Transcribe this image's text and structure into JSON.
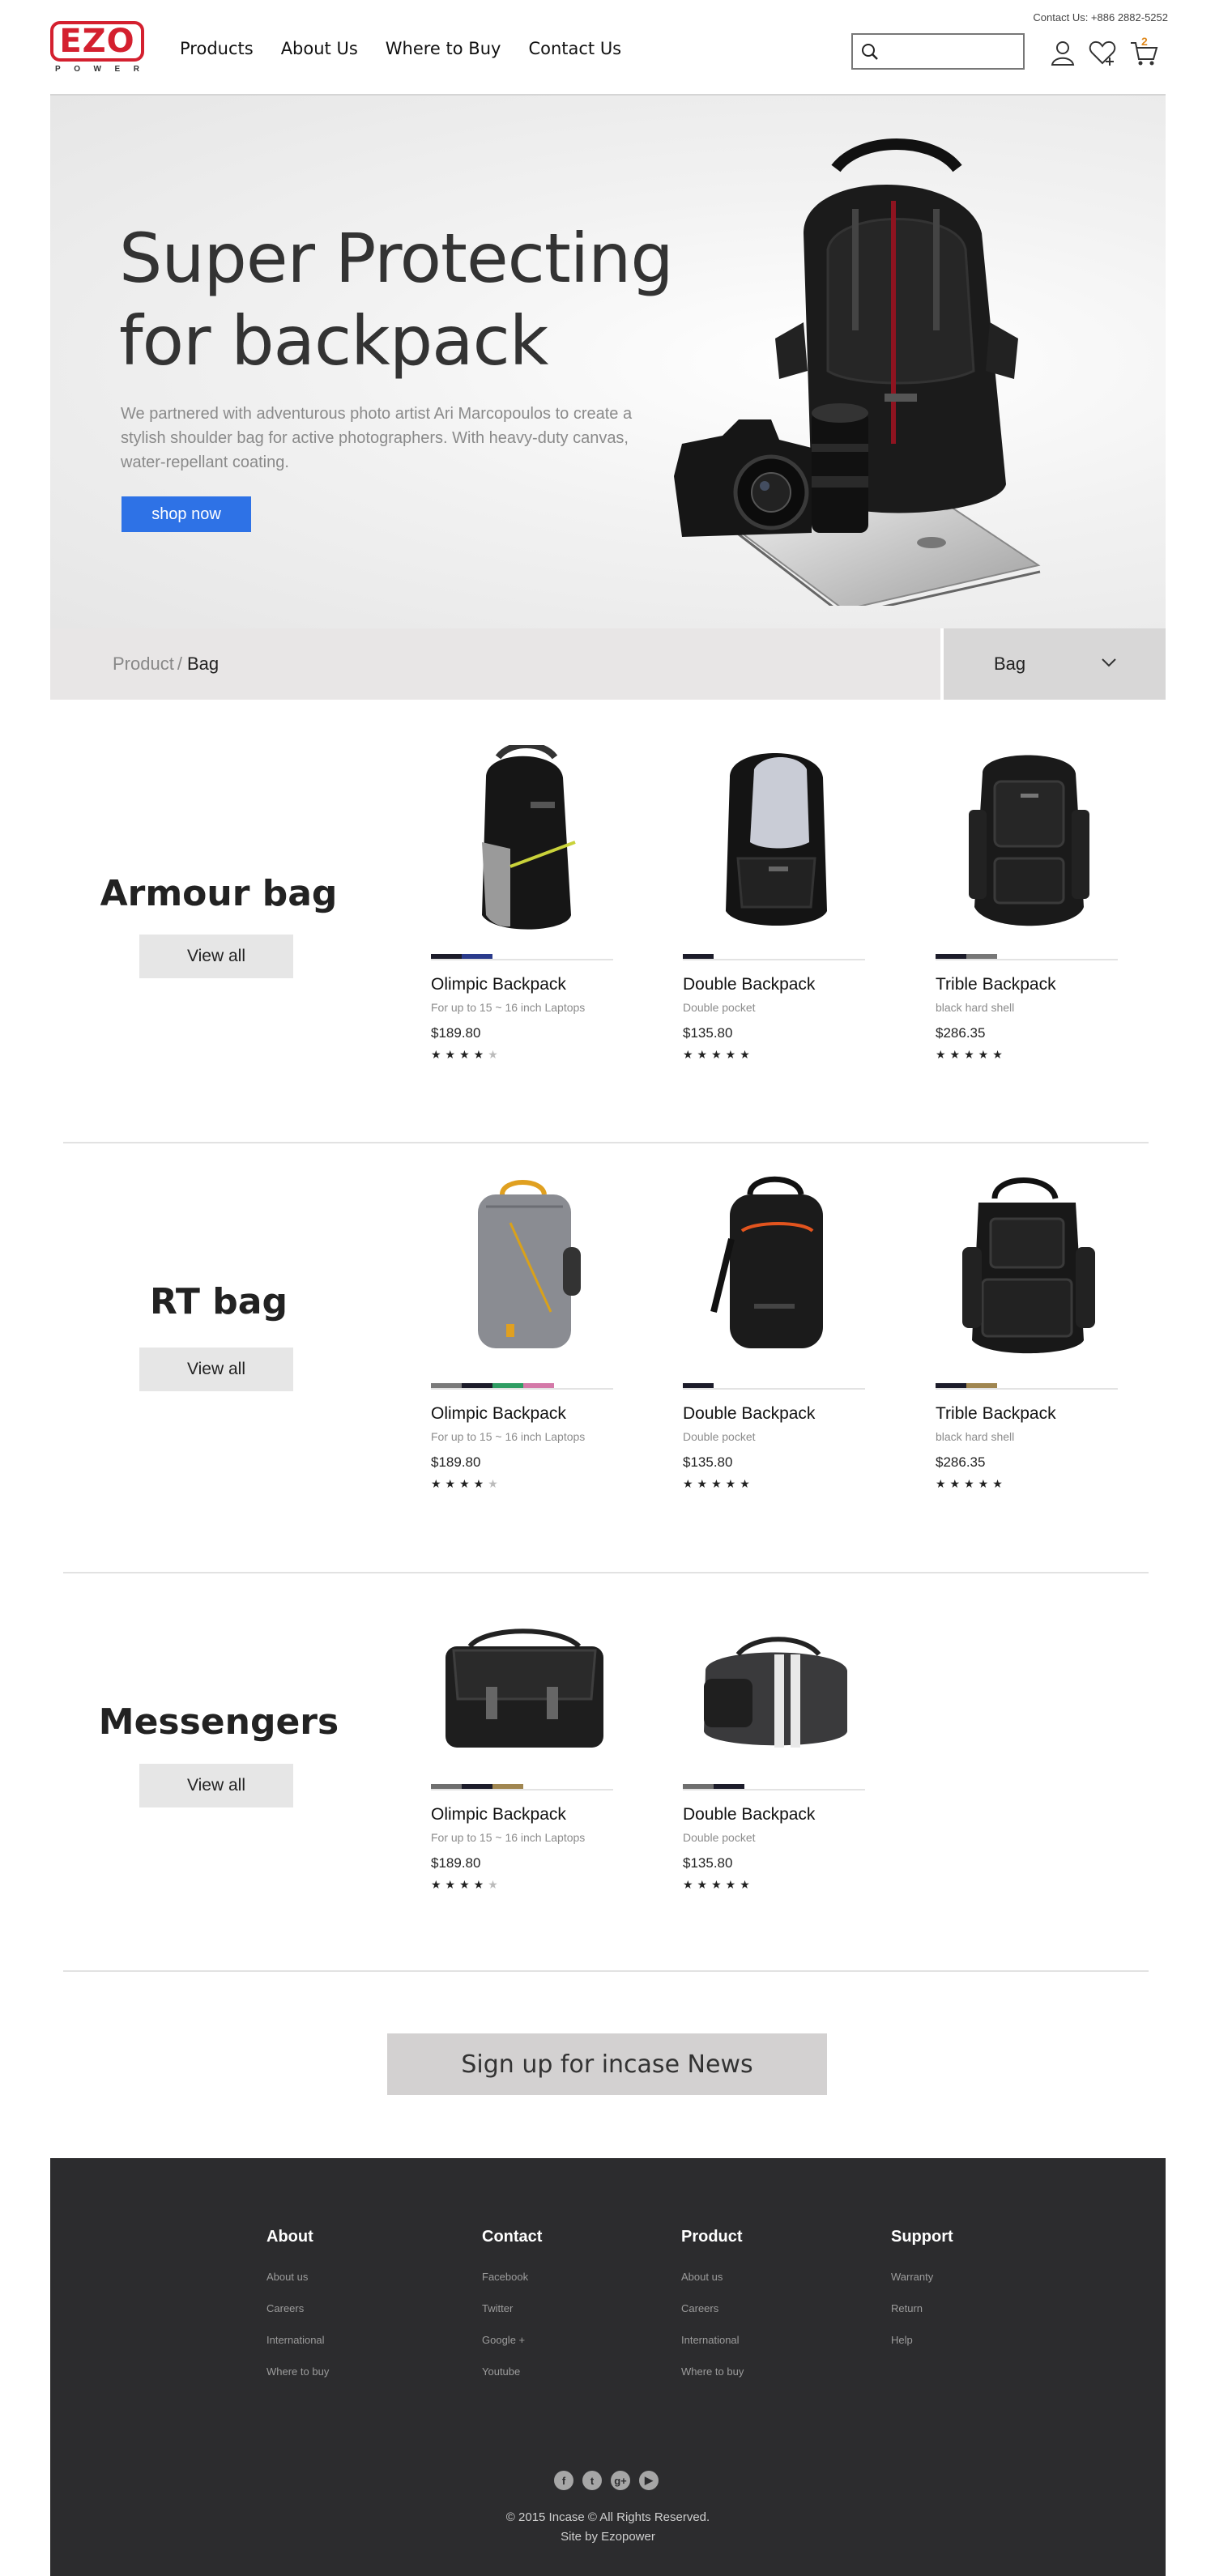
{
  "header": {
    "contact": "Contact Us: +886 2882-5252",
    "logo": {
      "main": "EZO",
      "sub": [
        "P",
        "O",
        "W",
        "E",
        "R"
      ]
    },
    "nav": [
      "Products",
      "About Us",
      "Where to Buy",
      "Contact Us"
    ],
    "search_placeholder": "",
    "cart_count": "2"
  },
  "hero": {
    "title_line1": "Super Protecting",
    "title_line2": "for backpack",
    "description": "We partnered with adventurous photo artist Ari Marcopoulos to create a stylish shoulder bag for active photographers. With heavy-duty canvas, water-repellant coating.",
    "button": "shop now"
  },
  "breadcrumb": {
    "parent": "Product",
    "separator": "/",
    "current": "Bag"
  },
  "category_select": {
    "value": "Bag"
  },
  "colors": {
    "accent": "#2e72e6",
    "brand": "#d4202f",
    "star_on": "#222222",
    "star_off": "#bbbbbb"
  },
  "sections": [
    {
      "title": "Armour bag",
      "view_all": "View all",
      "products": [
        {
          "name": "Olimpic Backpack",
          "sub": "For up to 15 ~ 16 inch Laptops",
          "price": "$189.80",
          "rating": 4,
          "swatches": [
            "#1c1c2a",
            "#2a3b8c"
          ]
        },
        {
          "name": "Double Backpack",
          "sub": "Double pocket",
          "price": "$135.80",
          "rating": 5,
          "swatches": [
            "#1c1c2a"
          ]
        },
        {
          "name": "Trible Backpack",
          "sub": "black hard shell",
          "price": "$286.35",
          "rating": 5,
          "swatches": [
            "#1c1c2a",
            "#777777"
          ]
        }
      ]
    },
    {
      "title": "RT bag",
      "view_all": "View all",
      "products": [
        {
          "name": "Olimpic Backpack",
          "sub": "For up to 15 ~ 16 inch Laptops",
          "price": "$189.80",
          "rating": 4,
          "swatches": [
            "#7a7a7a",
            "#1c1c2a",
            "#2f9d63",
            "#d479a8"
          ]
        },
        {
          "name": "Double Backpack",
          "sub": "Double pocket",
          "price": "$135.80",
          "rating": 5,
          "swatches": [
            "#1c1c2a"
          ]
        },
        {
          "name": "Trible Backpack",
          "sub": "black hard shell",
          "price": "$286.35",
          "rating": 5,
          "swatches": [
            "#1c1c2a",
            "#a08650"
          ]
        }
      ]
    },
    {
      "title": "Messengers",
      "view_all": "View all",
      "products": [
        {
          "name": "Olimpic Backpack",
          "sub": "For up to 15 ~ 16 inch Laptops",
          "price": "$189.80",
          "rating": 4,
          "swatches": [
            "#6f6f6f",
            "#1c1c2a",
            "#a08650"
          ]
        },
        {
          "name": "Double Backpack",
          "sub": "Double pocket",
          "price": "$135.80",
          "rating": 5,
          "swatches": [
            "#6f6f6f",
            "#1c1c2a"
          ]
        }
      ]
    }
  ],
  "signup": "Sign up for incase News",
  "footer": {
    "columns": [
      {
        "title": "About",
        "links": [
          "About us",
          "Careers",
          "International",
          "Where to buy"
        ]
      },
      {
        "title": "Contact",
        "links": [
          "Facebook",
          "Twitter",
          "Google +",
          "Youtube"
        ]
      },
      {
        "title": "Product",
        "links": [
          "About us",
          "Careers",
          "International",
          "Where to buy"
        ]
      },
      {
        "title": "Support",
        "links": [
          "Warranty",
          "Return",
          "Help"
        ]
      }
    ],
    "social": [
      "facebook-icon",
      "twitter-icon",
      "google-plus-icon",
      "youtube-icon"
    ],
    "copyright": "© 2015 Incase © All Rights Reserved.",
    "credit": "Site by Ezopower"
  }
}
